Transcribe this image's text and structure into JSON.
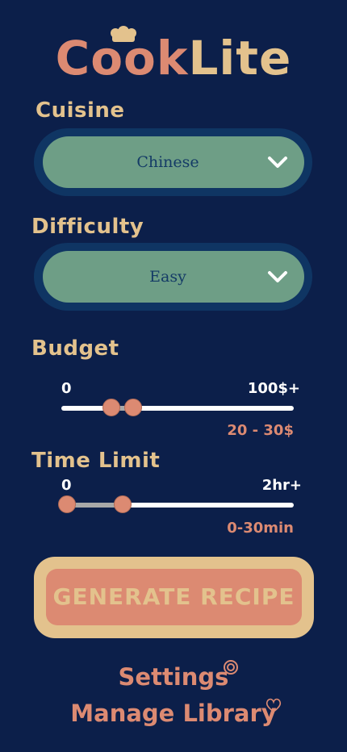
{
  "app": {
    "logo_text": "CookLite"
  },
  "cuisine": {
    "label": "Cuisine",
    "selected": "Chinese"
  },
  "difficulty": {
    "label": "Difficulty",
    "selected": "Easy"
  },
  "budget": {
    "label": "Budget",
    "min_label": "0",
    "max_label": "100$+",
    "readout": "20 - 30$",
    "range_low": 0.2,
    "range_high": 0.3
  },
  "time_limit": {
    "label": "Time Limit",
    "min_label": "0",
    "max_label": "2hr+",
    "readout": "0-30min",
    "range_low": 0.0,
    "range_high": 0.25
  },
  "generate": {
    "label": "GENERATE RECIPE"
  },
  "links": {
    "settings": "Settings",
    "library": "Manage Library"
  },
  "colors": {
    "background": "#0c1f4a",
    "accent_tan": "#e3c28d",
    "accent_salmon": "#dc8a72",
    "select_green": "#6e9e86",
    "select_ring": "#0f3563"
  }
}
